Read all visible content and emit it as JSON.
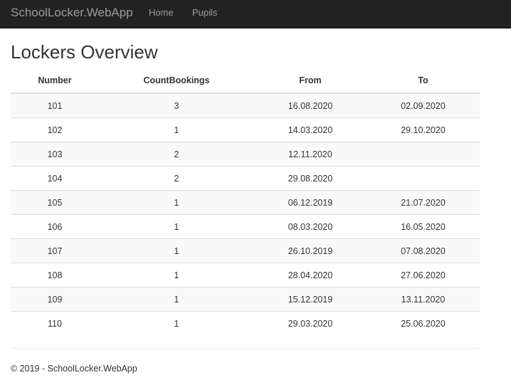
{
  "navbar": {
    "brand": "SchoolLocker.WebApp",
    "links": [
      "Home",
      "Pupils"
    ]
  },
  "page": {
    "title": "Lockers Overview"
  },
  "table": {
    "headers": [
      "Number",
      "CountBookings",
      "From",
      "To"
    ],
    "rows": [
      [
        "101",
        "3",
        "16.08.2020",
        "02.09.2020"
      ],
      [
        "102",
        "1",
        "14.03.2020",
        "29.10.2020"
      ],
      [
        "103",
        "2",
        "12.11.2020",
        ""
      ],
      [
        "104",
        "2",
        "29.08.2020",
        ""
      ],
      [
        "105",
        "1",
        "06.12.2019",
        "21.07.2020"
      ],
      [
        "106",
        "1",
        "08.03.2020",
        "16.05.2020"
      ],
      [
        "107",
        "1",
        "26.10.2019",
        "07.08.2020"
      ],
      [
        "108",
        "1",
        "28.04.2020",
        "27.06.2020"
      ],
      [
        "109",
        "1",
        "15.12.2019",
        "13.11.2020"
      ],
      [
        "110",
        "1",
        "29.03.2020",
        "25.06.2020"
      ]
    ]
  },
  "footer": {
    "text": "© 2019 - SchoolLocker.WebApp"
  },
  "colors": {
    "navbar_bg": "#222222",
    "navbar_text": "#9d9d9d",
    "row_stripe": "#f9f9f9",
    "border": "#dddddd"
  }
}
